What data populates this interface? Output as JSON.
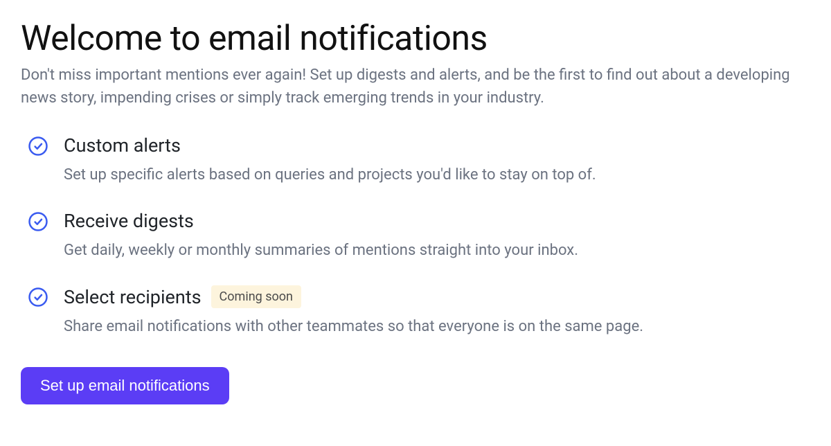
{
  "header": {
    "title": "Welcome to email notifications",
    "subtitle": "Don't miss important mentions ever again! Set up digests and alerts, and be the first to find out about a developing news story, impending crises or simply track emerging trends in your industry."
  },
  "features": [
    {
      "title": "Custom alerts",
      "description": "Set up specific alerts based on queries and projects you'd like to stay on top of.",
      "badge": null
    },
    {
      "title": "Receive digests",
      "description": "Get daily, weekly or monthly summaries of mentions straight into your inbox.",
      "badge": null
    },
    {
      "title": "Select recipients",
      "description": "Share email notifications with other teammates so that everyone is on the same page.",
      "badge": "Coming soon"
    }
  ],
  "cta": {
    "label": "Set up email notifications"
  },
  "colors": {
    "accent": "#5b3df5",
    "check_stroke": "#3a5bf0",
    "badge_bg": "#fdf4dd",
    "muted_text": "#6b7280"
  }
}
